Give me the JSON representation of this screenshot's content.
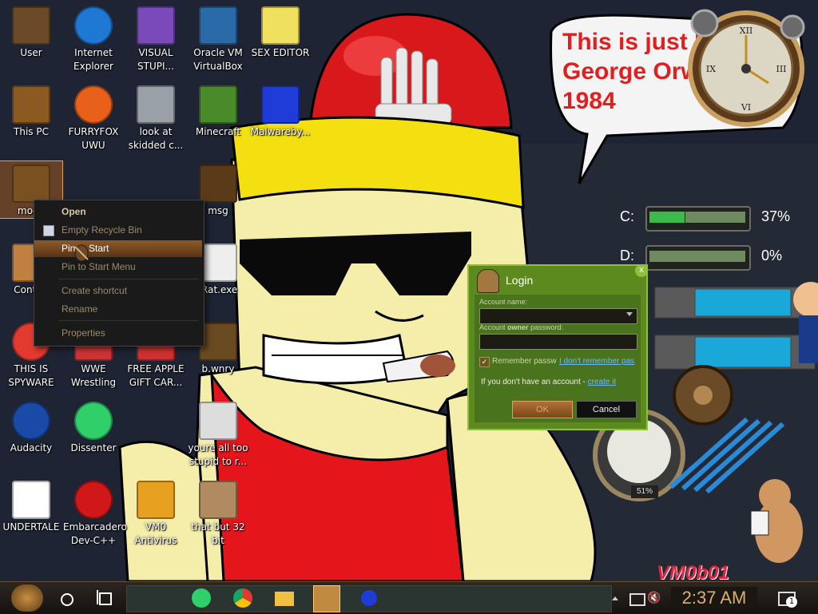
{
  "desktop_icons": [
    {
      "label": "User"
    },
    {
      "label": "Internet Explorer"
    },
    {
      "label": "VISUAL STUPI..."
    },
    {
      "label": "Oracle VM VirtualBox"
    },
    {
      "label": "SEX EDITOR"
    },
    {
      "label": "This PC"
    },
    {
      "label": "FURRYFOX UWU"
    },
    {
      "label": "look at skidded c..."
    },
    {
      "label": "Minecraft"
    },
    {
      "label": "Malwareby..."
    },
    {
      "label": "moon"
    },
    {
      "label": "msg"
    },
    {
      "label": "Control"
    },
    {
      "label": "jRat.exe"
    },
    {
      "label": "THIS IS SPYWARE"
    },
    {
      "label": "WWE Wrestling"
    },
    {
      "label": "FREE APPLE GIFT CAR..."
    },
    {
      "label": "b.wnry"
    },
    {
      "label": "Audacity"
    },
    {
      "label": "Dissenter"
    },
    {
      "label": "youre all too stupid to r..."
    },
    {
      "label": "UNDERTALE"
    },
    {
      "label": "Embarcadero Dev-C++"
    },
    {
      "label": "VM0 Antivirus"
    },
    {
      "label": "that but 32 bit"
    }
  ],
  "context_menu": {
    "items": [
      "Open",
      "Empty Recycle Bin",
      "Pin to Start",
      "Pin to Start Menu",
      "Create shortcut",
      "Rename",
      "Properties"
    ]
  },
  "speech_bubble": {
    "line1": "This is just like",
    "line2": "George Orwell's",
    "line3": "1984"
  },
  "drives": [
    {
      "label": "C:",
      "percent": "37%",
      "fill": 0.37
    },
    {
      "label": "D:",
      "percent": "0%",
      "fill": 0.0
    }
  ],
  "gauge_readout": "51%",
  "watermark": "VM0b01",
  "login": {
    "title": "Login",
    "account_name_label": "Account name:",
    "password_label_pre": "Account ",
    "password_label_bold": "owner",
    "password_label_post": " password:",
    "remember": "Remember passw",
    "forgot": "I don't remember pas",
    "no_account": "If you don't have an account - ",
    "create": "create it",
    "ok": "OK",
    "cancel": "Cancel",
    "close": "x"
  },
  "taskbar": {
    "time": "2:37 AM",
    "notification_count": "1"
  },
  "colors": {
    "accent": "#8b5a2a",
    "login_green": "#5d8a1e",
    "bubble_text": "#e02020"
  }
}
